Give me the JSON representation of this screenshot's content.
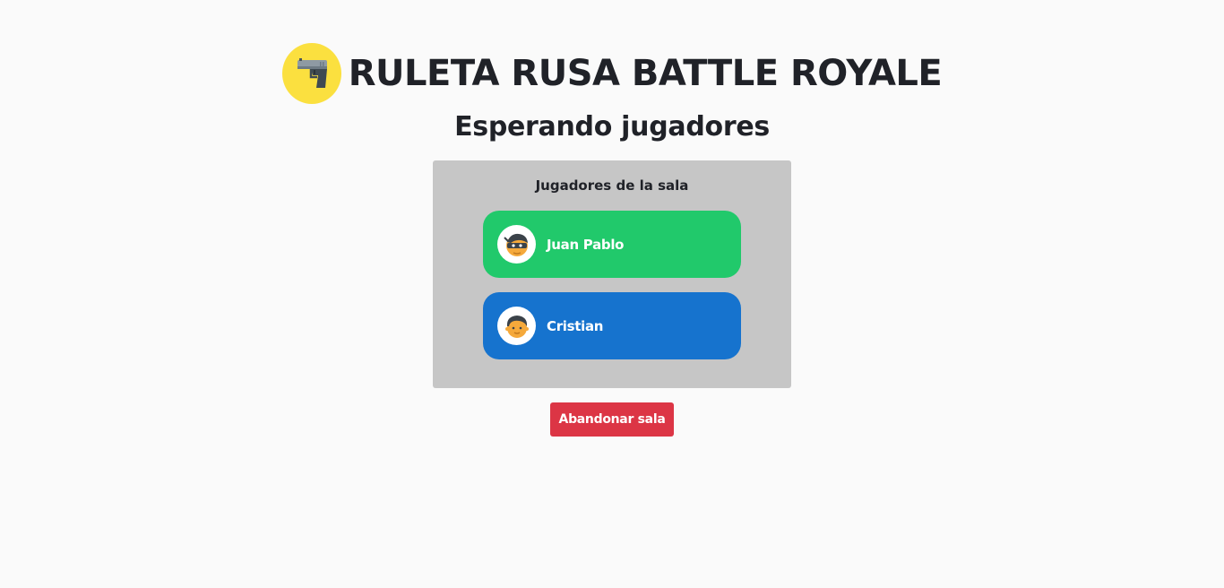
{
  "header": {
    "title": "RULETA RUSA BATTLE ROYALE",
    "logo_icon": "pistol-icon",
    "logo_bg": "#fbe03f"
  },
  "subtitle": "Esperando jugadores",
  "room": {
    "title": "Jugadores de la sala",
    "players": [
      {
        "name": "Juan Pablo",
        "avatar_icon": "ninja-face-icon",
        "color": "#21c96b"
      },
      {
        "name": "Cristian",
        "avatar_icon": "boy-face-icon",
        "color": "#1673ce"
      }
    ]
  },
  "actions": {
    "leave_label": "Abandonar sala",
    "leave_color": "#dc3545"
  }
}
